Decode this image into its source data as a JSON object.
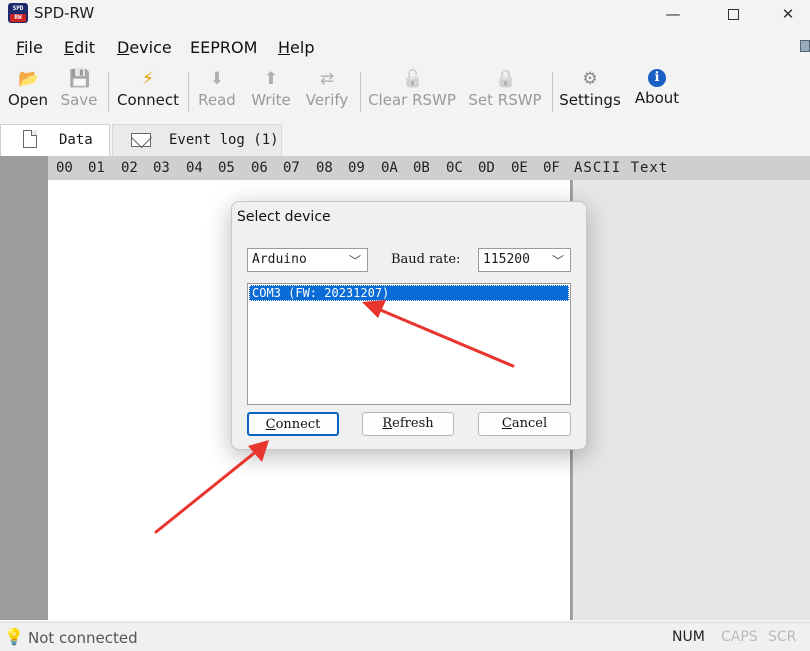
{
  "window": {
    "title": "SPD-RW",
    "icon_top": "SPD",
    "icon_bottom": "RW",
    "minimize": "—",
    "close": "✕"
  },
  "menu": {
    "items": [
      {
        "label": "File",
        "accel": "F",
        "rest": "ile"
      },
      {
        "label": "Edit",
        "accel": "E",
        "rest": "dit"
      },
      {
        "label": "Device",
        "accel": "D",
        "rest": "evice"
      },
      {
        "label": "EEPROM",
        "accel": "",
        "rest": "EEPROM"
      },
      {
        "label": "Help",
        "accel": "H",
        "rest": "elp"
      }
    ]
  },
  "toolbar": {
    "open": {
      "label": "Open",
      "icon": "📂"
    },
    "save": {
      "label": "Save",
      "icon": "💾"
    },
    "connect": {
      "label": "Connect",
      "icon": "⚡"
    },
    "read": {
      "label": "Read",
      "icon": "⬇"
    },
    "write": {
      "label": "Write",
      "icon": "⬆"
    },
    "verify": {
      "label": "Verify",
      "icon": "⇄"
    },
    "clear_rswp": {
      "label": "Clear RSWP",
      "icon": "🔓"
    },
    "set_rswp": {
      "label": "Set RSWP",
      "icon": "🔒"
    },
    "settings": {
      "label": "Settings",
      "icon": "⚙"
    },
    "about": {
      "label": "About",
      "icon": "ℹ"
    }
  },
  "tabs": {
    "data": "Data",
    "event_log": "Event log (1)"
  },
  "hex_header": [
    "00",
    "01",
    "02",
    "03",
    "04",
    "05",
    "06",
    "07",
    "08",
    "09",
    "0A",
    "0B",
    "0C",
    "0D",
    "0E",
    "0F"
  ],
  "ascii_header": "ASCII Text",
  "status": {
    "connection": "Not connected",
    "num": "NUM",
    "caps": "CAPS",
    "scr": "SCR"
  },
  "dialog": {
    "title": "Select device",
    "device_type": "Arduino",
    "baud_label": "Baud rate:",
    "baud_value": "115200",
    "devices": [
      "COM3 (FW: 20231207)"
    ],
    "connect": {
      "accel": "C",
      "rest": "onnect"
    },
    "refresh": {
      "accel": "R",
      "rest": "efresh"
    },
    "cancel": {
      "accel": "C",
      "rest": "ancel"
    }
  },
  "annotation_color": "#e8352d"
}
